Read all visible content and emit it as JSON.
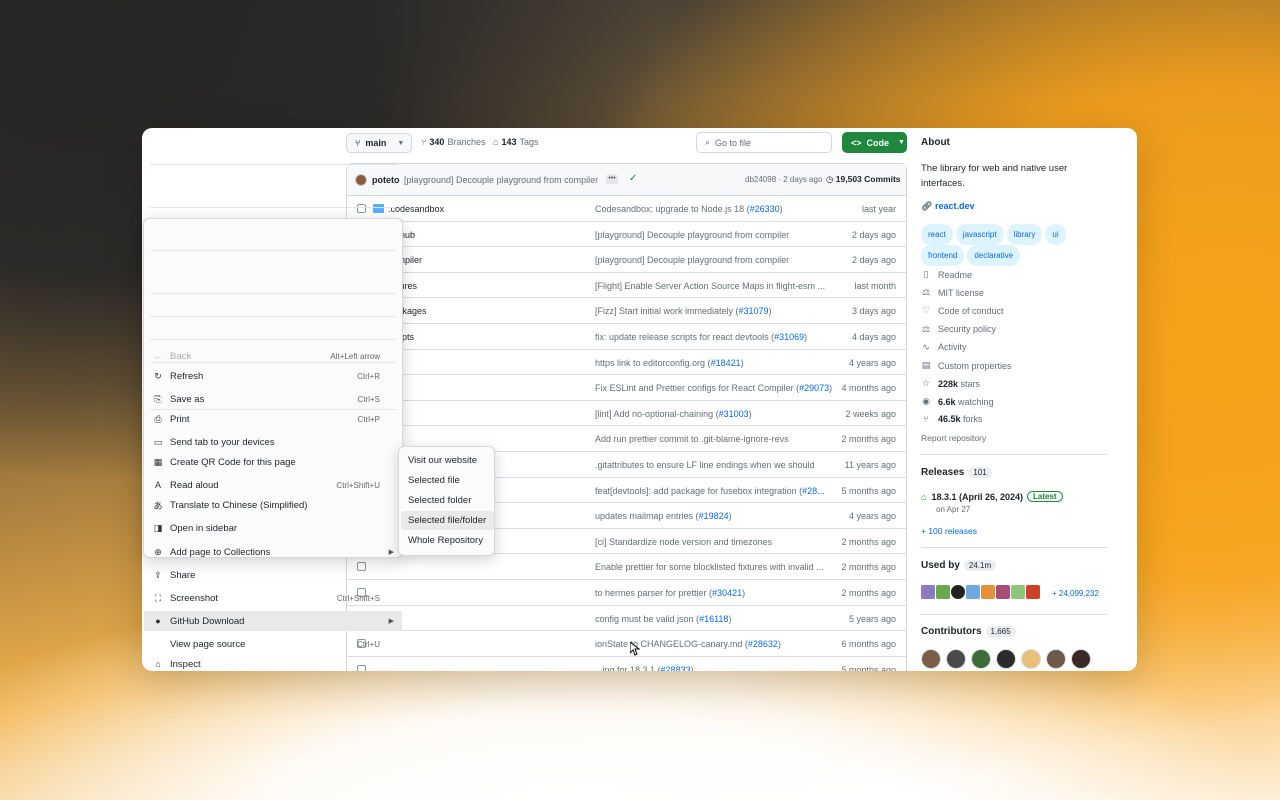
{
  "toolbar": {
    "branch": "main",
    "branches_count": "340",
    "branches_label": "Branches",
    "tags_count": "143",
    "tags_label": "Tags",
    "goto_placeholder": "Go to file",
    "code_label": "Code"
  },
  "latest_commit": {
    "author": "poteto",
    "message": "[playground] Decouple playground from compiler",
    "hash_time": "db24098 · 2 days ago",
    "commits": "19,503 Commits"
  },
  "files": [
    {
      "name": ".codesandbox",
      "msg": "Codesandbox: upgrade to Node.js 18 (",
      "pr": "#26330",
      "msg_end": ")",
      "time": "last year",
      "checked": false
    },
    {
      "name": ".github",
      "msg": "[playground] Decouple playground from compiler",
      "pr": "",
      "msg_end": "",
      "time": "2 days ago",
      "checked": false
    },
    {
      "name": "compiler",
      "msg": "[playground] Decouple playground from compiler",
      "pr": "",
      "msg_end": "",
      "time": "2 days ago",
      "checked": false
    },
    {
      "name": "fixtures",
      "msg": "[Flight] Enable Server Action Source Maps in flight-esm ...",
      "pr": "",
      "msg_end": "",
      "time": "last month",
      "checked": false
    },
    {
      "name": "packages",
      "msg": "[Fizz] Start initial work immediately (",
      "pr": "#31079",
      "msg_end": ")",
      "time": "3 days ago",
      "checked": true
    },
    {
      "name": "scripts",
      "msg": "fix: update release scripts for react devtools (",
      "pr": "#31069",
      "msg_end": ")",
      "time": "4 days ago",
      "checked": true
    },
    {
      "name": "",
      "msg": "https link to editorconfig.org (",
      "pr": "#18421",
      "msg_end": ")",
      "time": "4 years ago",
      "checked": false
    },
    {
      "name": "",
      "msg": "Fix ESLint and Prettier configs for React Compiler (",
      "pr": "#29073",
      "msg_end": ")",
      "time": "4 months ago",
      "checked": false
    },
    {
      "name": "",
      "msg": "[lint] Add no-optional-chaining (",
      "pr": "#31003",
      "msg_end": ")",
      "time": "2 weeks ago",
      "checked": false
    },
    {
      "name": "",
      "msg": "Add run prettier commit to .git-blame-ignore-revs",
      "pr": "",
      "msg_end": "",
      "time": "2 months ago",
      "checked": false
    },
    {
      "name": "",
      "msg": ".gitattributes to ensure LF line endings when we should",
      "pr": "",
      "msg_end": "",
      "time": "11 years ago",
      "checked": false
    },
    {
      "name": "",
      "msg": "feat[devtools]: add package for fusebox integration (",
      "pr": "#28...",
      "msg_end": "",
      "time": "5 months ago",
      "checked": false
    },
    {
      "name": "",
      "msg": "updates mailmap entries (",
      "pr": "#19824",
      "msg_end": ")",
      "time": "4 years ago",
      "checked": false
    },
    {
      "name": "",
      "msg": "[ci] Standardize node version and timezones",
      "pr": "",
      "msg_end": "",
      "time": "2 months ago",
      "checked": false
    },
    {
      "name": "",
      "msg": "Enable prettier for some blocklisted fixtures with invalid ...",
      "pr": "",
      "msg_end": "",
      "time": "2 months ago",
      "checked": false
    },
    {
      "name": "",
      "msg": "to hermes parser for prettier (",
      "pr": "#30421",
      "msg_end": ")",
      "time": "2 months ago",
      "checked": false
    },
    {
      "name": "",
      "msg": "config must be valid json (",
      "pr": "#16118",
      "msg_end": ")",
      "time": "5 years ago",
      "checked": false
    },
    {
      "name": "",
      "msg": "ionState to CHANGELOG-canary.md (",
      "pr": "#28632",
      "msg_end": ")",
      "time": "6 months ago",
      "checked": false
    },
    {
      "name": "",
      "msg": "...ing for 18.3.1 (",
      "pr": "#28833",
      "msg_end": ")",
      "time": "5 months ago",
      "checked": false
    }
  ],
  "about": {
    "heading": "About",
    "description": "The library for web and native user interfaces.",
    "website": "react.dev",
    "topics": [
      "react",
      "javascript",
      "library",
      "ui",
      "frontend",
      "declarative"
    ],
    "items": [
      "Readme",
      "MIT license",
      "Code of conduct",
      "Security policy",
      "Activity",
      "Custom properties"
    ],
    "stars": "228k",
    "stars_label": "stars",
    "watching": "6.6k",
    "watching_label": "watching",
    "forks": "46.5k",
    "forks_label": "forks",
    "report": "Report repository"
  },
  "releases": {
    "heading": "Releases",
    "count": "101",
    "latest_name": "18.3.1 (April 26, 2024)",
    "latest_badge": "Latest",
    "latest_date": "on Apr 27",
    "more": "+ 100 releases"
  },
  "used_by": {
    "heading": "Used by",
    "count": "24.1m",
    "more": "+ 24,099,232"
  },
  "contributors": {
    "heading": "Contributors",
    "count": "1,665"
  },
  "context_menu": {
    "items": [
      {
        "label": "Back",
        "shortcut": "Alt+Left arrow",
        "icon": "back-arrow-icon",
        "glyph": "←",
        "disabled": true
      },
      {
        "label": "Refresh",
        "shortcut": "Ctrl+R",
        "icon": "refresh-icon",
        "glyph": "↻"
      },
      {
        "label": "Save as",
        "shortcut": "Ctrl+S",
        "icon": "save-icon",
        "glyph": "⎘"
      },
      {
        "label": "Print",
        "shortcut": "Ctrl+P",
        "icon": "print-icon",
        "glyph": "⎙"
      },
      {
        "label": "Send tab to your devices",
        "shortcut": "",
        "icon": "devices-icon",
        "glyph": "▭"
      },
      {
        "label": "Create QR Code for this page",
        "shortcut": "",
        "icon": "qr-code-icon",
        "glyph": "▦"
      },
      {
        "label": "Read aloud",
        "shortcut": "Ctrl+Shift+U",
        "icon": "read-aloud-icon",
        "glyph": "A"
      },
      {
        "label": "Translate to Chinese (Simplified)",
        "shortcut": "",
        "icon": "translate-icon",
        "glyph": "あ"
      },
      {
        "label": "Open in sidebar",
        "shortcut": "",
        "icon": "sidebar-icon",
        "glyph": "◨"
      },
      {
        "label": "Add page to Collections",
        "shortcut": "",
        "icon": "collections-icon",
        "glyph": "⊕",
        "submenu": true
      },
      {
        "label": "Share",
        "shortcut": "",
        "icon": "share-icon",
        "glyph": "⇪"
      },
      {
        "label": "Screenshot",
        "shortcut": "Ctrl+Shift+S",
        "icon": "screenshot-icon",
        "glyph": "⛶"
      },
      {
        "label": "GitHub Download",
        "shortcut": "",
        "icon": "github-download-icon",
        "glyph": "●",
        "submenu": true,
        "highlight": true
      },
      {
        "label": "View page source",
        "shortcut": "Ctrl+U",
        "icon": "",
        "glyph": ""
      },
      {
        "label": "Inspect",
        "shortcut": "",
        "icon": "inspect-icon",
        "glyph": "⌂"
      }
    ]
  },
  "submenu": {
    "items": [
      "Visit our website",
      "Selected file",
      "Selected folder",
      "Selected file/folder",
      "Whole Repository"
    ],
    "highlight_index": 3
  }
}
